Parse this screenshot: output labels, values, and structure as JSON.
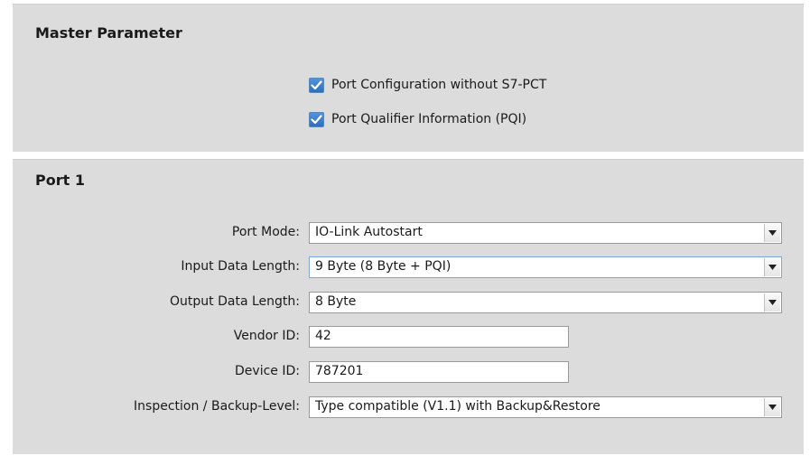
{
  "master": {
    "title": "Master Parameter",
    "options": [
      {
        "label": "Port Configuration without S7-PCT",
        "checked": true
      },
      {
        "label": "Port Qualifier Information (PQI)",
        "checked": true
      }
    ]
  },
  "port": {
    "title": "Port 1",
    "port_mode": {
      "label": "Port Mode:",
      "value": "IO-Link Autostart"
    },
    "input_length": {
      "label": "Input Data Length:",
      "value": "9 Byte (8 Byte + PQI)"
    },
    "output_length": {
      "label": "Output Data Length:",
      "value": "8 Byte"
    },
    "vendor_id": {
      "label": "Vendor ID:",
      "value": "42"
    },
    "device_id": {
      "label": "Device ID:",
      "value": "787201"
    },
    "inspection": {
      "label": "Inspection / Backup-Level:",
      "value": "Type compatible (V1.1) with Backup&Restore"
    }
  },
  "colors": {
    "panel_bg": "#dcdcdc",
    "checkbox_accent": "#2d6fbf"
  },
  "icons": {
    "checkbox": "checkmark-icon",
    "dropdown": "chevron-down-icon"
  }
}
